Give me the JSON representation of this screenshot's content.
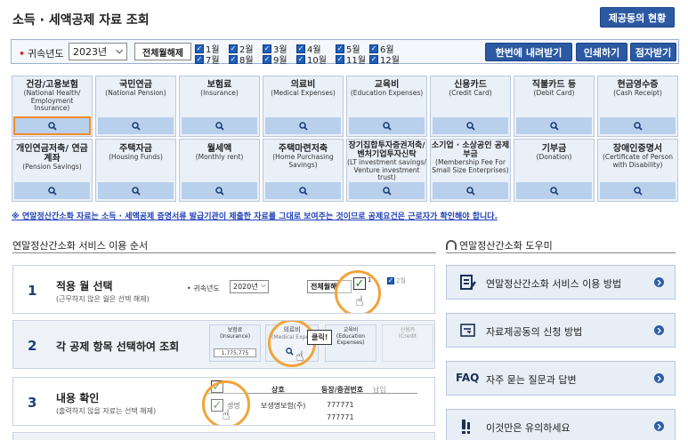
{
  "page": {
    "title": "소득 · 세액공제 자료 조회",
    "provider_button": "제공동의 현황"
  },
  "filter": {
    "year_label": "귀속년도",
    "year_value": "2023년",
    "release_all": "전체월해제",
    "months": [
      "1월",
      "2월",
      "3월",
      "4월",
      "5월",
      "6월",
      "7월",
      "8월",
      "9월",
      "10월",
      "11월",
      "12월"
    ],
    "download_all": "한번에 내려받기",
    "print": "인쇄하기",
    "braille": "점자받기"
  },
  "categories": [
    {
      "ko": "건강/고용보험",
      "en": "(National Health/ Employment Insurance)"
    },
    {
      "ko": "국민연금",
      "en": "(National Pension)"
    },
    {
      "ko": "보험료",
      "en": "(Insurance)"
    },
    {
      "ko": "의료비",
      "en": "(Medical Expenses)"
    },
    {
      "ko": "교육비",
      "en": "(Education Expenses)"
    },
    {
      "ko": "신용카드",
      "en": "(Credit Card)"
    },
    {
      "ko": "직불카드 등",
      "en": "(Debit Card)"
    },
    {
      "ko": "현금영수증",
      "en": "(Cash Receipt)"
    },
    {
      "ko": "개인연금저축/ 연금계좌",
      "en": "(Pension Savings)"
    },
    {
      "ko": "주택자금",
      "en": "(Housing Funds)"
    },
    {
      "ko": "월세액",
      "en": "(Monthly rent)"
    },
    {
      "ko": "주택마련저축",
      "en": "(Home Purchasing Savings)"
    },
    {
      "ko": "장기집합투자증권저축/ 벤처기업투자신탁",
      "en": "(LT investment savings/ Venture investment trust)"
    },
    {
      "ko": "소기업 · 소상공인 공제부금",
      "en": "(Membership Fee For Small Size Enterprises)"
    },
    {
      "ko": "기부금",
      "en": "(Donation)"
    },
    {
      "ko": "장애인증명서",
      "en": "(Certificate of Person with Disability)"
    }
  ],
  "notice": "※ 연말정산간소화 자료는 소득 · 세액공제 증명서류 발급기관이 제출한 자료를 그대로 보여주는 것이므로 공제요건은 근로자가 확인해야 합니다.",
  "steps_section": {
    "title": "연말정산간소화 서비스 이용 순서",
    "steps": [
      {
        "num": "1",
        "title": "적용 월 선택",
        "sub": "(근무하지 않은 월은 선택 해제)"
      },
      {
        "num": "2",
        "title": "각 공제 항목 선택하여 조회",
        "sub": ""
      },
      {
        "num": "3",
        "title": "내용 확인",
        "sub": "(출력하지 않을 자료는 선택 해제)"
      }
    ],
    "mock1": {
      "year_label": "귀속년도",
      "year_value": "2020년",
      "release": "전체월해",
      "m1": "1",
      "m2": "2",
      "m3": "2월"
    },
    "mock2": {
      "insurance": "보험료",
      "insurance_en": "(Insurance)",
      "amount": "1,775,775",
      "medical": "의료비",
      "medical_en": "(Medical Expen",
      "click": "클릭!",
      "edu": "교육비",
      "edu_en": "(Education Expenses)",
      "credit": "신용카",
      "credit_en": "(Credit"
    },
    "mock3": {
      "col1": "상호",
      "col2": "등장/증권번호",
      "col3": "납입",
      "item": "생명",
      "company": "보생명보험(주)",
      "code1": "777771",
      "code2": "777771"
    }
  },
  "help_section": {
    "title": "연말정산간소화 도우미",
    "items": [
      {
        "label": "연말정산간소화 서비스 이용 방법",
        "icon": "book-icon"
      },
      {
        "label": "자료제공동의 신청 방법",
        "icon": "document-icon"
      },
      {
        "prefix": "FAQ",
        "label": "자주 묻는 질문과 답변",
        "icon": "faq-icon"
      },
      {
        "label": "이것만은 유의하세요",
        "icon": "exclamation-icon"
      }
    ]
  },
  "colors": {
    "primary": "#2b5aa3",
    "card": "#eaf0f8",
    "search": "#b9d0ec",
    "highlight": "#f08c28",
    "notice": "#2040b8"
  }
}
